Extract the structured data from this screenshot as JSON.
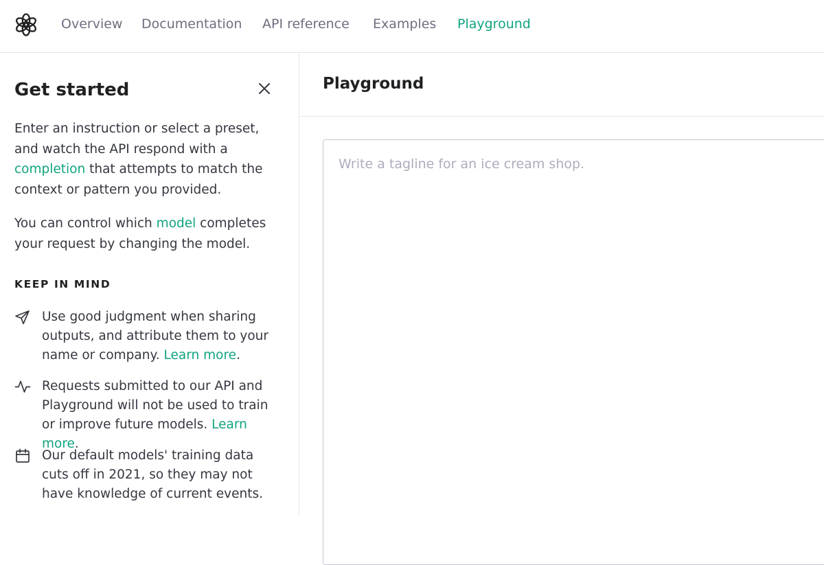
{
  "nav": {
    "logo_icon": "openai-logo-icon",
    "links": [
      "Overview",
      "Documentation",
      "API reference",
      "Examples",
      "Playground"
    ],
    "active": "Playground",
    "accent_color": "#10a37f"
  },
  "sidebar": {
    "title": "Get started",
    "close_icon": "close-icon",
    "intro": {
      "before": "Enter an instruction or select a preset, and watch the API respond with a ",
      "link": "completion",
      "after": " that attempts to match the context or pattern you provided."
    },
    "model_para": {
      "before": "You can control which ",
      "link": "model",
      "after": " completes your request by changing the model."
    },
    "keep_in_mind": "KEEP IN MIND",
    "tips": [
      {
        "icon": "paper-plane-icon",
        "text": "Use good judgment when sharing outputs, and attribute them to your name or company. ",
        "link": "Learn more",
        "after": "."
      },
      {
        "icon": "activity-icon",
        "text": "Requests submitted to our API and Playground will not be used to train or improve future models. ",
        "link": "Learn more",
        "after": "."
      },
      {
        "icon": "calendar-icon",
        "text": "Our default models' training data cuts off in 2021, so they may not have knowledge of current events.",
        "link": "",
        "after": ""
      }
    ]
  },
  "main": {
    "title": "Playground",
    "prompt": {
      "placeholder": "Write a tagline for an ice cream shop.",
      "value": ""
    }
  }
}
